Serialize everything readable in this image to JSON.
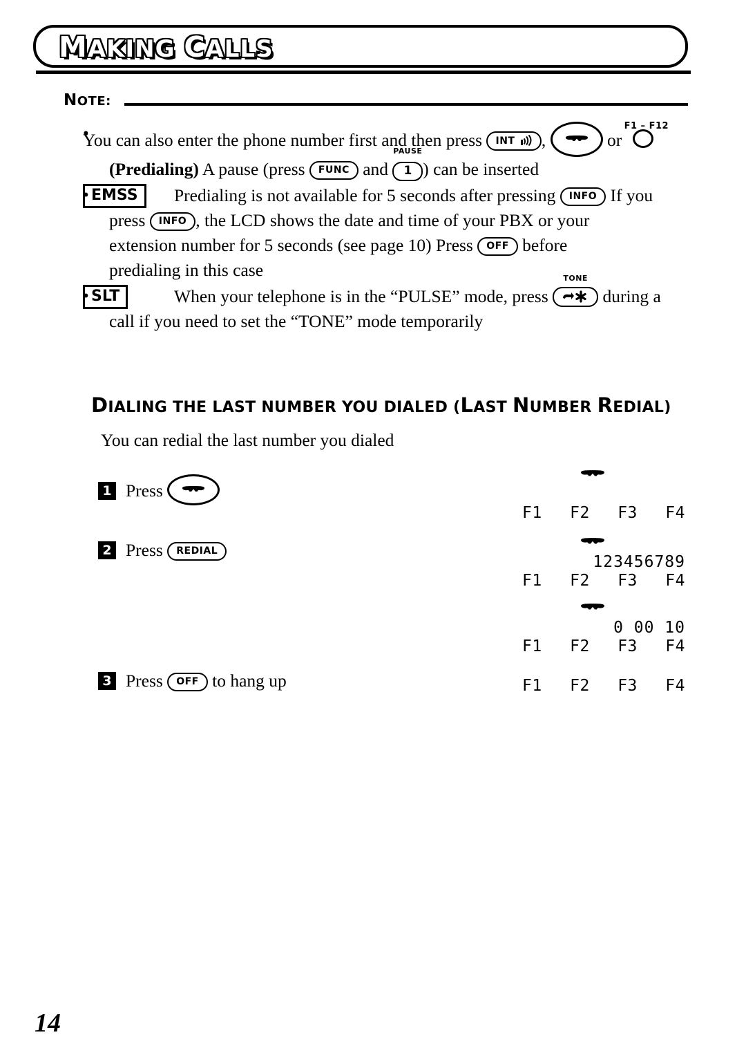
{
  "header": {
    "title_parts": [
      {
        "text": "M",
        "cap": true
      },
      {
        "text": "AKING ",
        "cap": false
      },
      {
        "text": "C",
        "cap": true
      },
      {
        "text": "ALLS",
        "cap": false
      }
    ],
    "title": "MAKING CALLS"
  },
  "note": {
    "label_parts": [
      {
        "text": "N",
        "cap": true
      },
      {
        "text": "OTE:",
        "cap": false
      }
    ],
    "label": "NOTE:",
    "items": [
      {
        "bullet": "•",
        "line1_a": "You can also enter the phone number first and then press",
        "key_int": "INT",
        "key_int_icon": "antenna-icon",
        "comma": ",",
        "key_handset_icon": "handset-icon",
        "or": "or",
        "fkey_label": "F1 – F12",
        "line2_a": "(Predialing)",
        "line2_b": "A pause (press",
        "key_func": "FUNC",
        "and": "and",
        "key_pause_top": "PAUSE",
        "key_pause": "1",
        "line2_c": ") can be inserted"
      },
      {
        "bullet": "•",
        "tag": "EMSS",
        "line1_a": "Predialing is not available for 5 seconds after pressing",
        "key_info_1": "INFO",
        "line1_b": "If you",
        "line2_a": "press",
        "key_info_2": "INFO",
        "line2_b": ", the LCD shows the date and time of your PBX or your",
        "line3_a": "extension number for 5 seconds (see page 10)  Press",
        "key_off": "OFF",
        "line3_b": "before",
        "line4": "predialing in this case"
      },
      {
        "bullet": "•",
        "tag": "SLT",
        "line1_a": "When your telephone is in the “PULSE” mode, press",
        "key_tone_top": "TONE",
        "key_tone_icon": "tone-star-icon",
        "line1_b": "during a",
        "line2": "call if you need to set the “TONE” mode temporarily"
      }
    ]
  },
  "section": {
    "heading_parts": [
      {
        "text": "D",
        "cap": true
      },
      {
        "text": "IALING THE LAST NUMBER YOU DIALED (",
        "cap": false
      },
      {
        "text": "L",
        "cap": true
      },
      {
        "text": "AST ",
        "cap": false
      },
      {
        "text": "N",
        "cap": true
      },
      {
        "text": "UMBER ",
        "cap": false
      },
      {
        "text": "R",
        "cap": true
      },
      {
        "text": "EDIAL)",
        "cap": false
      }
    ],
    "heading": "DIALING THE LAST NUMBER YOU DIALED (LAST NUMBER REDIAL)",
    "intro": "You can redial the last number you dialed",
    "steps": [
      {
        "num": "1",
        "text_before": "Press",
        "key": "handset-icon",
        "text_after": ""
      },
      {
        "num": "2",
        "text_before": "Press",
        "key": "REDIAL",
        "text_after": ""
      },
      {
        "num": "3",
        "text_before": "Press",
        "key": "OFF",
        "text_after": "to hang up"
      }
    ]
  },
  "lcd_panels": [
    {
      "handset": true,
      "number": "",
      "fkeys": [
        "F1",
        "F2",
        "F3",
        "F4"
      ]
    },
    {
      "handset": true,
      "number": "123456789",
      "fkeys": [
        "F1",
        "F2",
        "F3",
        "F4"
      ]
    },
    {
      "handset": true,
      "number": "0 00 10",
      "fkeys": [
        "F1",
        "F2",
        "F3",
        "F4"
      ]
    },
    {
      "handset": false,
      "number": "",
      "fkeys": [
        "F1",
        "F2",
        "F3",
        "F4"
      ]
    }
  ],
  "page_number": "14"
}
